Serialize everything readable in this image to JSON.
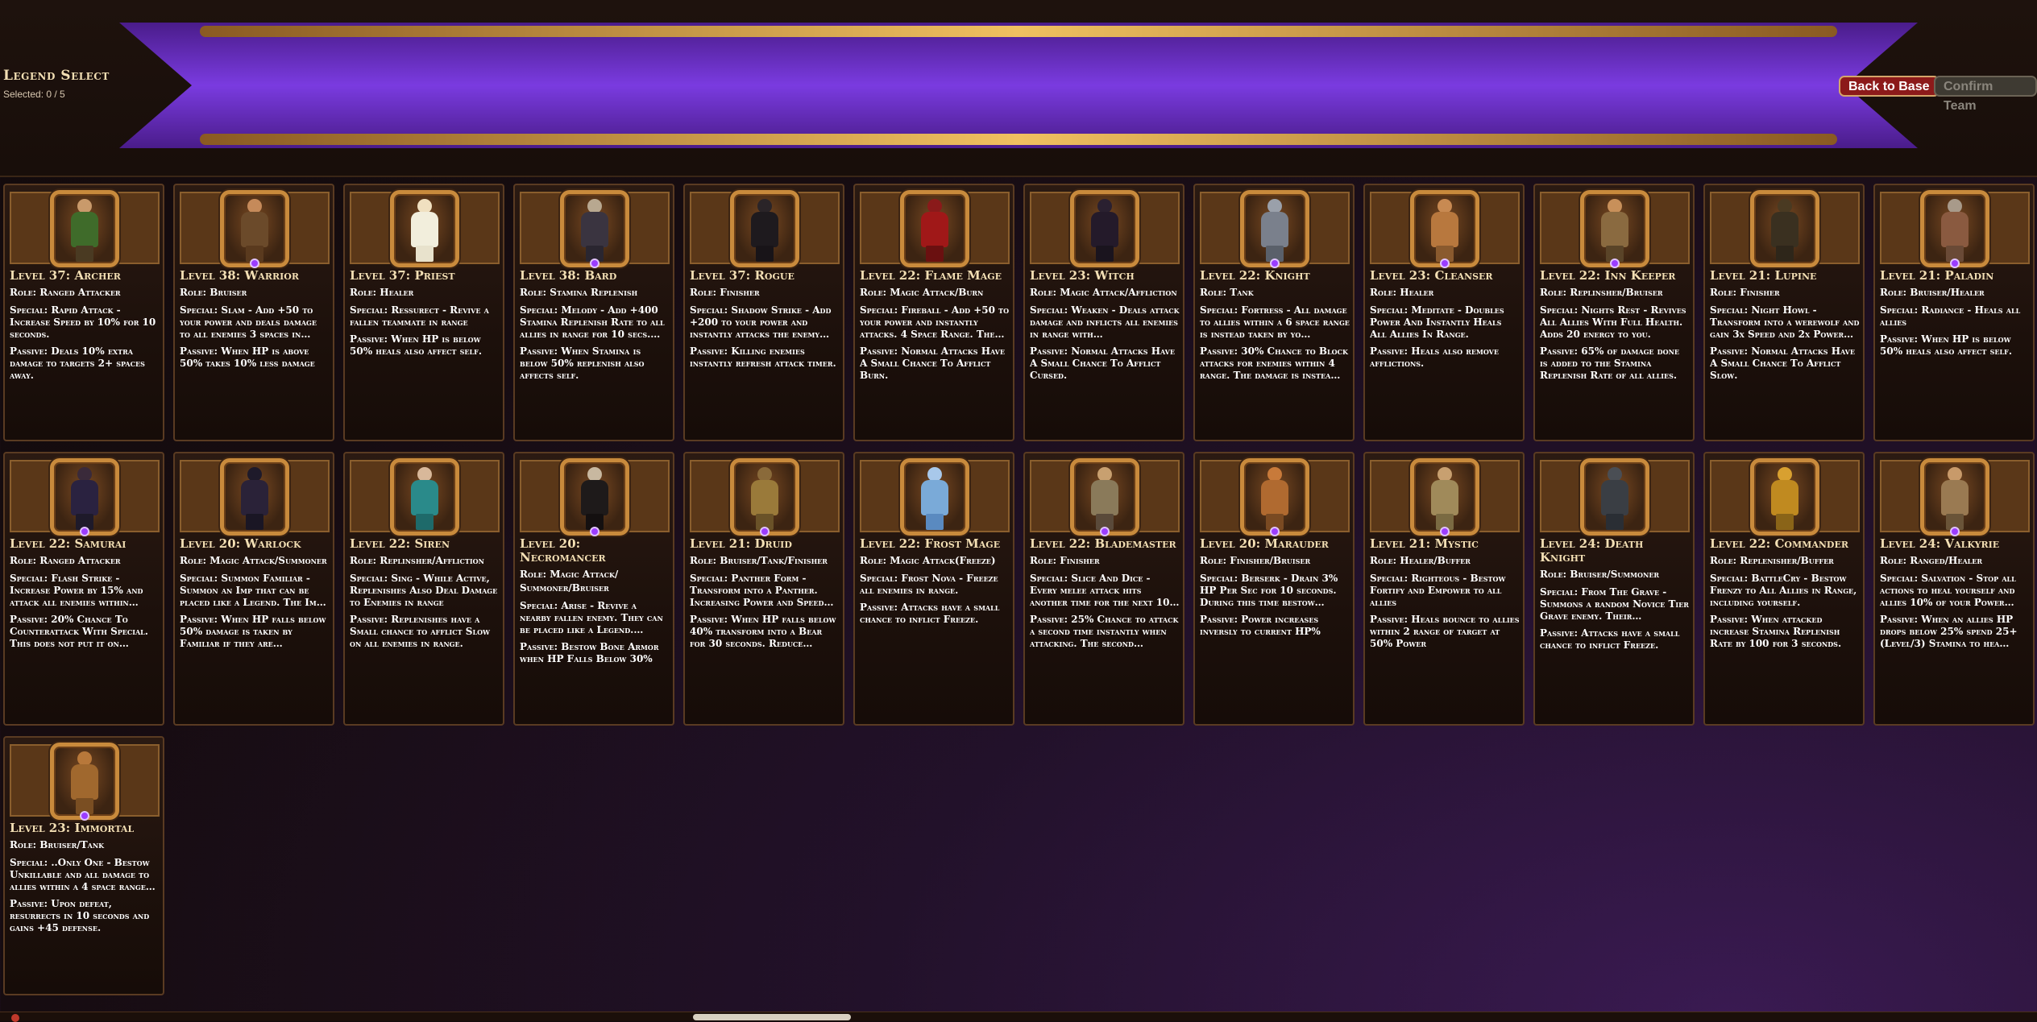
{
  "header": {
    "title": "Legend Select",
    "selected": "Selected: 0 / 5",
    "back_label": "Back to Base",
    "confirm_label": "Confirm Team"
  },
  "colors": {
    "banner_purple": "#6a2fd0",
    "gold": "#d99a3a",
    "back_button": "#8c1a1a",
    "gem": "#9b3cff"
  },
  "cards": [
    {
      "name": "Level 37: Archer",
      "role": "Role: Ranged Attacker",
      "special": "Special: Rapid Attack - Increase Speed by 10% for 10 seconds.",
      "passive": "Passive: Deals 10% extra damage to targets 2+ spaces away.",
      "skin": "#c99a6b",
      "cloth": "#3f6b2a",
      "legs": "#4a3a22",
      "gem": false
    },
    {
      "name": "Level 38: Warrior",
      "role": "Role: Bruiser",
      "special": "Special: Slam - Add +50 to your power and deals damage to all enemies 3 spaces in…",
      "passive": "Passive: When HP is above 50% takes 10% less damage",
      "skin": "#c58a5a",
      "cloth": "#6b4a2a",
      "legs": "#5a3a1e",
      "gem": true
    },
    {
      "name": "Level 37: Priest",
      "role": "Role: Healer",
      "special": "Special: Ressurect - Revive a fallen teammate in range",
      "passive": "Passive: When HP is below 50% heals also affect self.",
      "skin": "#f0e0c0",
      "cloth": "#f2eedc",
      "legs": "#e8e2cc",
      "gem": false
    },
    {
      "name": "Level 38: Bard",
      "role": "Role: Stamina Replenish",
      "special": "Special: Melody - Add +400 Stamina Replenish Rate to all allies in range for 10 secs.…",
      "passive": "Passive: When Stamina is below 50% replenish also affects self.",
      "skin": "#b8a890",
      "cloth": "#3a3440",
      "legs": "#2a2630",
      "gem": true
    },
    {
      "name": "Level 37: Rogue",
      "role": "Role: Finisher",
      "special": "Special: Shadow Strike - Add +200 to your power and instantly attacks the enemy…",
      "passive": "Passive: Killing enemies instantly refresh attack timer.",
      "skin": "#2a2428",
      "cloth": "#1e1a1e",
      "legs": "#181418",
      "gem": false
    },
    {
      "name": "Level 22: Flame Mage",
      "role": "Role: Magic Attack/Burn",
      "special": "Special: Fireball - Add +50 to your power and instantly attacks. 4 Space Range. The…",
      "passive": "Passive: Normal Attacks Have A Small Chance To Afflict Burn.",
      "skin": "#8a1a1a",
      "cloth": "#a01818",
      "legs": "#6a1010",
      "gem": false
    },
    {
      "name": "Level 23: Witch",
      "role": "Role: Magic Attack/Affliction",
      "special": "Special: Weaken - Deals attack damage and inflicts all enemies in range with…",
      "passive": "Passive: Normal Attacks Have A Small Chance To Afflict Cursed.",
      "skin": "#2a2030",
      "cloth": "#241a2a",
      "legs": "#1a141e",
      "gem": false
    },
    {
      "name": "Level 22: Knight",
      "role": "Role: Tank",
      "special": "Special: Fortress - All damage to allies within a 6 space range is instead taken by yo…",
      "passive": "Passive: 30% Chance to Block attacks for enemies within 4 range. The damage is instea…",
      "skin": "#9aa0aa",
      "cloth": "#7a808c",
      "legs": "#5a606a",
      "gem": true
    },
    {
      "name": "Level 23: Cleanser",
      "role": "Role: Healer",
      "special": "Special: Meditate - Doubles Power And Instantly Heals All Allies In Range.",
      "passive": "Passive: Heals also remove afflictions.",
      "skin": "#c88a52",
      "cloth": "#b8783e",
      "legs": "#8a5a2e",
      "gem": true
    },
    {
      "name": "Level 22: Inn Keeper",
      "role": "Role: Replinsher/Bruiser",
      "special": "Special: Nights Rest - Revives All Allies With Full Health. Adds 20 energy to you.",
      "passive": "Passive: 65% of damage done is added to the Stamina Replenish Rate of all allies.",
      "skin": "#c8905a",
      "cloth": "#8a6a40",
      "legs": "#5a4428",
      "gem": true
    },
    {
      "name": "Level 21: Lupine",
      "role": "Role: Finisher",
      "special": "Special: Night Howl - Transform into a werewolf and gain 3x Speed and 2x Power…",
      "passive": "Passive: Normal Attacks Have A Small Chance To Afflict Slow.",
      "skin": "#4a3a22",
      "cloth": "#3a3020",
      "legs": "#2e261a",
      "gem": false
    },
    {
      "name": "Level 21: Paladin",
      "role": "Role: Bruiser/Healer",
      "special": "Special: Radiance - Heals all allies",
      "passive": "Passive: When HP is below 50% heals also affect self.",
      "skin": "#a89a8a",
      "cloth": "#8a5a40",
      "legs": "#6a4a36",
      "gem": true
    },
    {
      "name": "Level 22: Samurai",
      "role": "Role: Ranged Attacker",
      "special": "Special: Flash Strike - Increase Power by 15% and attack all enemies within…",
      "passive": "Passive: 20% Chance To Counterattack With Special. This does not put it on…",
      "skin": "#3a2a3a",
      "cloth": "#2a2240",
      "legs": "#1e1a2a",
      "gem": true
    },
    {
      "name": "Level 20: Warlock",
      "role": "Role: Magic Attack/Summoner",
      "special": "Special: Summon Familiar - Summon an Imp that can be placed like a Legend. The Im…",
      "passive": "Passive: When HP falls below 50% damage is taken by Familiar if they are…",
      "skin": "#1e1a2a",
      "cloth": "#2a2238",
      "legs": "#1a1624",
      "gem": false
    },
    {
      "name": "Level 22: Siren",
      "role": "Role: Replinsher/Affliction",
      "special": "Special: Sing - While Active, Replenishes Also Deal Damage to Enemies in range",
      "passive": "Passive: Replenishes have a Small chance to afflict Slow on all enemies in range.",
      "skin": "#d8b89a",
      "cloth": "#2a8a8a",
      "legs": "#1e6a6a",
      "gem": false
    },
    {
      "name": "Level 20: Necromancer",
      "role": "Role: Magic Attack/ Summoner/Bruiser",
      "special": "Special: Arise - Revive a nearby fallen enemy. They can be placed like a Legend.…",
      "passive": "Passive: Bestow Bone Armor when HP Falls Below 30%",
      "skin": "#c8b8a0",
      "cloth": "#1e1a1a",
      "legs": "#141010",
      "gem": true
    },
    {
      "name": "Level 21: Druid",
      "role": "Role: Bruiser/Tank/Finisher",
      "special": "Special: Panther Form - Transform into a Panther. Increasing Power and Speed…",
      "passive": "Passive: When HP falls below 40% transform into a Bear for 30 seconds. Reduce Power…",
      "skin": "#8a6a3a",
      "cloth": "#9a7a3a",
      "legs": "#6a5228",
      "gem": true
    },
    {
      "name": "Level 22: Frost Mage",
      "role": "Role: Magic Attack(Freeze)",
      "special": "Special: Frost Nova - Freeze all enemies in range.",
      "passive": "Passive: Attacks have a small chance to inflict Freeze.",
      "skin": "#a8c8ea",
      "cloth": "#7aaad8",
      "legs": "#5a8ac0",
      "gem": false
    },
    {
      "name": "Level 22: Blademaster",
      "role": "Role: Finisher",
      "special": "Special: Slice And Dice - Every melee attack hits another time for the next 10…",
      "passive": "Passive: 25% Chance to attack a second time instantly when attacking. The second…",
      "skin": "#c8a070",
      "cloth": "#8a7a5a",
      "legs": "#5a4a3a",
      "gem": true
    },
    {
      "name": "Level 20: Marauder",
      "role": "Role: Finisher/Bruiser",
      "special": "Special: Berserk - Drain 3% HP Per Sec for 10 seconds. During this time bestow…",
      "passive": "Passive: Power increases inversly to current HP%",
      "skin": "#c87a3a",
      "cloth": "#b06a30",
      "legs": "#7a4a22",
      "gem": true
    },
    {
      "name": "Level 21: Mystic",
      "role": "Role: Healer/Buffer",
      "special": "Special: Righteous - Bestow Fortify and Empower to all allies",
      "passive": "Passive: Heals bounce to allies within 2 range of target at 50% Power",
      "skin": "#c8a070",
      "cloth": "#a08a5a",
      "legs": "#7a6a42",
      "gem": true
    },
    {
      "name": "Level 24: Death Knight",
      "role": "Role: Bruiser/Summoner",
      "special": "Special: From The Grave - Summons a random Novice Tier Grave enemy. Their…",
      "passive": "Passive: Attacks have a small chance to inflict Freeze.",
      "skin": "#4a4e54",
      "cloth": "#3a3e44",
      "legs": "#2a2e34",
      "gem": false
    },
    {
      "name": "Level 22: Commander",
      "role": "Role: Replenisher/Buffer",
      "special": "Special: BattleCry - Bestow Frenzy to All Allies in Range, including yourself.",
      "passive": "Passive: When attacked increase Stamina Replenish Rate by 100 for 3 seconds.",
      "skin": "#d8a030",
      "cloth": "#c08a20",
      "legs": "#8a6418",
      "gem": false
    },
    {
      "name": "Level 24: Valkyrie",
      "role": "Role: Ranged/Healer",
      "special": "Special: Salvation - Stop all actions to heal yourself and allies 10% of your Power…",
      "passive": "Passive: When an allies HP drops below 25% spend 25+(Level/3) Stamina to hea…",
      "skin": "#c89a6a",
      "cloth": "#9a7a52",
      "legs": "#6a5438",
      "gem": true
    },
    {
      "name": "Level 23: Immortal",
      "role": "Role: Bruiser/Tank",
      "special": "Special: ..Only One - Bestow Unkillable and all damage to allies within a 4 space range…",
      "passive": "Passive: Upon defeat, resurrects in 10 seconds and gains +45 defense.",
      "skin": "#b8783a",
      "cloth": "#a0682e",
      "legs": "#7a4e22",
      "gem": true
    }
  ]
}
